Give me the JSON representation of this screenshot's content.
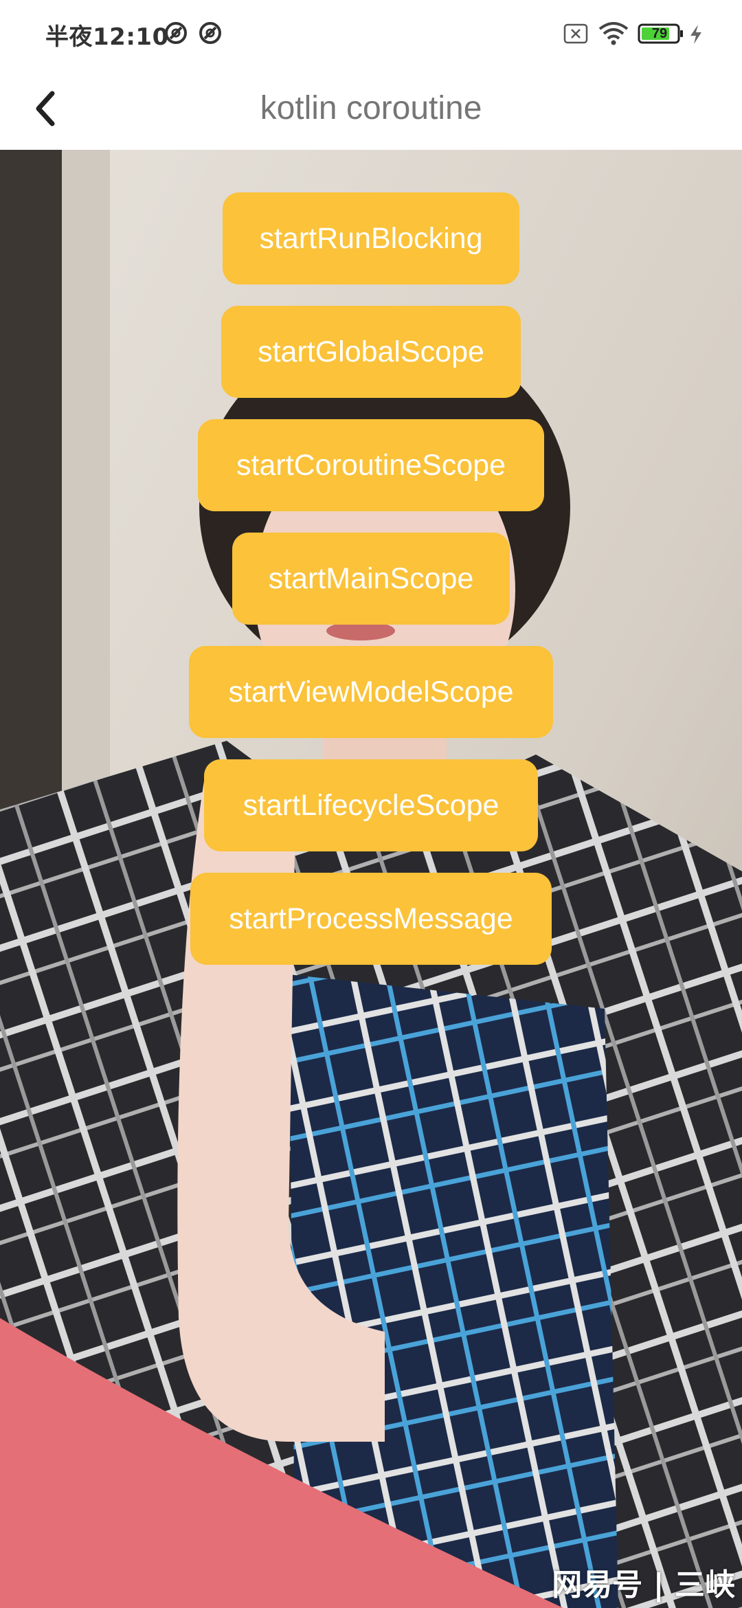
{
  "status_bar": {
    "time": "半夜12:10",
    "battery_level": "79",
    "icons": [
      "dnd-icon",
      "dnd-icon",
      "sim-off-icon",
      "wifi-icon",
      "battery-icon",
      "charging-icon"
    ]
  },
  "toolbar": {
    "title": "kotlin coroutine",
    "back_icon": "chevron-left-icon"
  },
  "buttons": [
    {
      "label": "startRunBlocking"
    },
    {
      "label": "startGlobalScope"
    },
    {
      "label": "startCoroutineScope"
    },
    {
      "label": "startMainScope"
    },
    {
      "label": "startViewModelScope"
    },
    {
      "label": "startLifecycleScope"
    },
    {
      "label": "startProcessMessage"
    }
  ],
  "background": {
    "watermark": "网易号 | 三峡"
  },
  "colors": {
    "button": "#fbc23a",
    "button_text": "#ffffff",
    "title": "#757575",
    "battery_fill": "#4cd137"
  }
}
